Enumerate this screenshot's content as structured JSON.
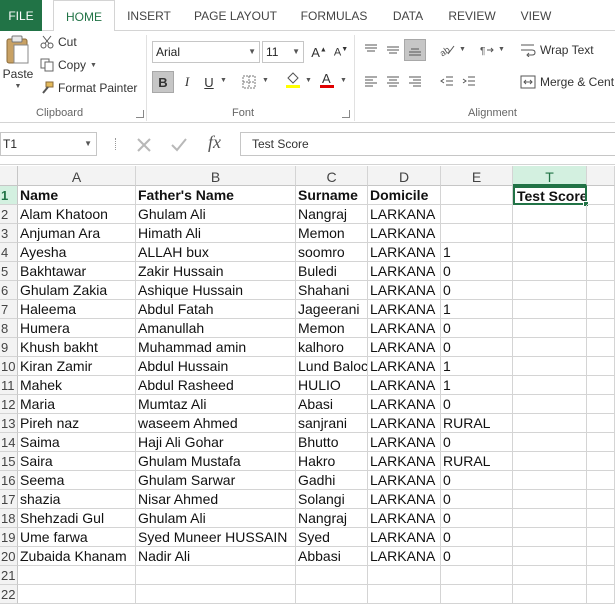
{
  "ribbon_tabs": [
    "FILE",
    "HOME",
    "INSERT",
    "PAGE LAYOUT",
    "FORMULAS",
    "DATA",
    "REVIEW",
    "VIEW"
  ],
  "clipboard": {
    "paste": "Paste",
    "cut": "Cut",
    "copy": "Copy",
    "format_painter": "Format Painter",
    "group_label": "Clipboard"
  },
  "font": {
    "name": "Arial",
    "size": "11",
    "bold": "B",
    "italic": "I",
    "underline": "U",
    "group_label": "Font"
  },
  "alignment": {
    "wrap_text": "Wrap Text",
    "merge_center": "Merge & Cent",
    "group_label": "Alignment"
  },
  "formula_bar": {
    "name_box": "T1",
    "fx": "fx",
    "value": "Test Score"
  },
  "columns": [
    {
      "letter": "A",
      "selected": false
    },
    {
      "letter": "B",
      "selected": false
    },
    {
      "letter": "C",
      "selected": false
    },
    {
      "letter": "D",
      "selected": false
    },
    {
      "letter": "E",
      "selected": false
    },
    {
      "letter": "",
      "selected": false
    },
    {
      "letter": "T",
      "selected": true
    },
    {
      "letter": "",
      "selected": false
    }
  ],
  "rows": [
    {
      "num": "1",
      "a": "Name",
      "b": "Father's Name",
      "c": "Surname",
      "d": "Domicile",
      "e": "",
      "t": "Test Score"
    },
    {
      "num": "2",
      "a": "Alam Khatoon",
      "b": "Ghulam Ali",
      "c": " Nangraj",
      "d": "LARKANA",
      "e": "",
      "t": ""
    },
    {
      "num": "3",
      "a": "Anjuman Ara",
      "b": "Himath Ali",
      "c": "Memon",
      "d": "LARKANA",
      "e": "",
      "t": ""
    },
    {
      "num": "4",
      "a": "Ayesha",
      "b": "ALLAH bux",
      "c": "soomro",
      "d": "LARKANA",
      "e": "1",
      "t": ""
    },
    {
      "num": "5",
      "a": "Bakhtawar",
      "b": "Zakir Hussain",
      "c": "Buledi",
      "d": "LARKANA",
      "e": "0",
      "t": ""
    },
    {
      "num": "6",
      "a": "Ghulam Zakia",
      "b": "Ashique Hussain",
      "c": "Shahani",
      "d": "LARKANA",
      "e": "0",
      "t": ""
    },
    {
      "num": "7",
      "a": "Haleema",
      "b": "Abdul Fatah",
      "c": "Jageerani",
      "d": "LARKANA",
      "e": "1",
      "t": ""
    },
    {
      "num": "8",
      "a": "Humera",
      "b": "Amanullah",
      "c": "Memon",
      "d": "LARKANA",
      "e": "0",
      "t": ""
    },
    {
      "num": "9",
      "a": "Khush bakht",
      "b": "Muhammad amin",
      "c": "kalhoro",
      "d": "LARKANA",
      "e": "0",
      "t": ""
    },
    {
      "num": "10",
      "a": "Kiran Zamir",
      "b": "Abdul Hussain",
      "c": "Lund Baloch",
      "d": "LARKANA",
      "e": "1",
      "t": ""
    },
    {
      "num": "11",
      "a": "Mahek",
      "b": "Abdul Rasheed",
      "c": "HULIO",
      "d": "LARKANA",
      "e": "1",
      "t": ""
    },
    {
      "num": "12",
      "a": "Maria",
      "b": "Mumtaz Ali",
      "c": "Abasi",
      "d": "LARKANA",
      "e": "0",
      "t": ""
    },
    {
      "num": "13",
      "a": "Pireh naz",
      "b": "waseem Ahmed",
      "c": "sanjrani",
      "d": "LARKANA",
      "e": "RURAL",
      "t": ""
    },
    {
      "num": "14",
      "a": "Saima",
      "b": "Haji Ali Gohar",
      "c": "Bhutto",
      "d": "LARKANA",
      "e": "0",
      "t": ""
    },
    {
      "num": "15",
      "a": "Saira",
      "b": "Ghulam Mustafa",
      "c": "Hakro",
      "d": "LARKANA",
      "e": "RURAL",
      "t": ""
    },
    {
      "num": "16",
      "a": "Seema",
      "b": "Ghulam Sarwar",
      "c": "Gadhi",
      "d": "LARKANA",
      "e": "0",
      "t": ""
    },
    {
      "num": "17",
      "a": "shazia",
      "b": "Nisar Ahmed",
      "c": "Solangi",
      "d": "LARKANA",
      "e": "0",
      "t": ""
    },
    {
      "num": "18",
      "a": "Shehzadi Gul",
      "b": "Ghulam Ali",
      "c": "Nangraj",
      "d": "LARKANA",
      "e": "0",
      "t": ""
    },
    {
      "num": "19",
      "a": "Ume farwa",
      "b": "Syed Muneer HUSSAIN",
      "c": "Syed",
      "d": "LARKANA",
      "e": "0",
      "t": ""
    },
    {
      "num": "20",
      "a": "Zubaida Khanam",
      "b": "Nadir Ali",
      "c": "Abbasi",
      "d": "LARKANA",
      "e": "0",
      "t": ""
    },
    {
      "num": "21",
      "a": "",
      "b": "",
      "c": "",
      "d": "",
      "e": "",
      "t": ""
    },
    {
      "num": "22",
      "a": "",
      "b": "",
      "c": "",
      "d": "",
      "e": "",
      "t": ""
    }
  ],
  "colors": {
    "accent": "#217346",
    "header_bg": "#f3f3f3",
    "gridline": "#d4d4d4"
  }
}
